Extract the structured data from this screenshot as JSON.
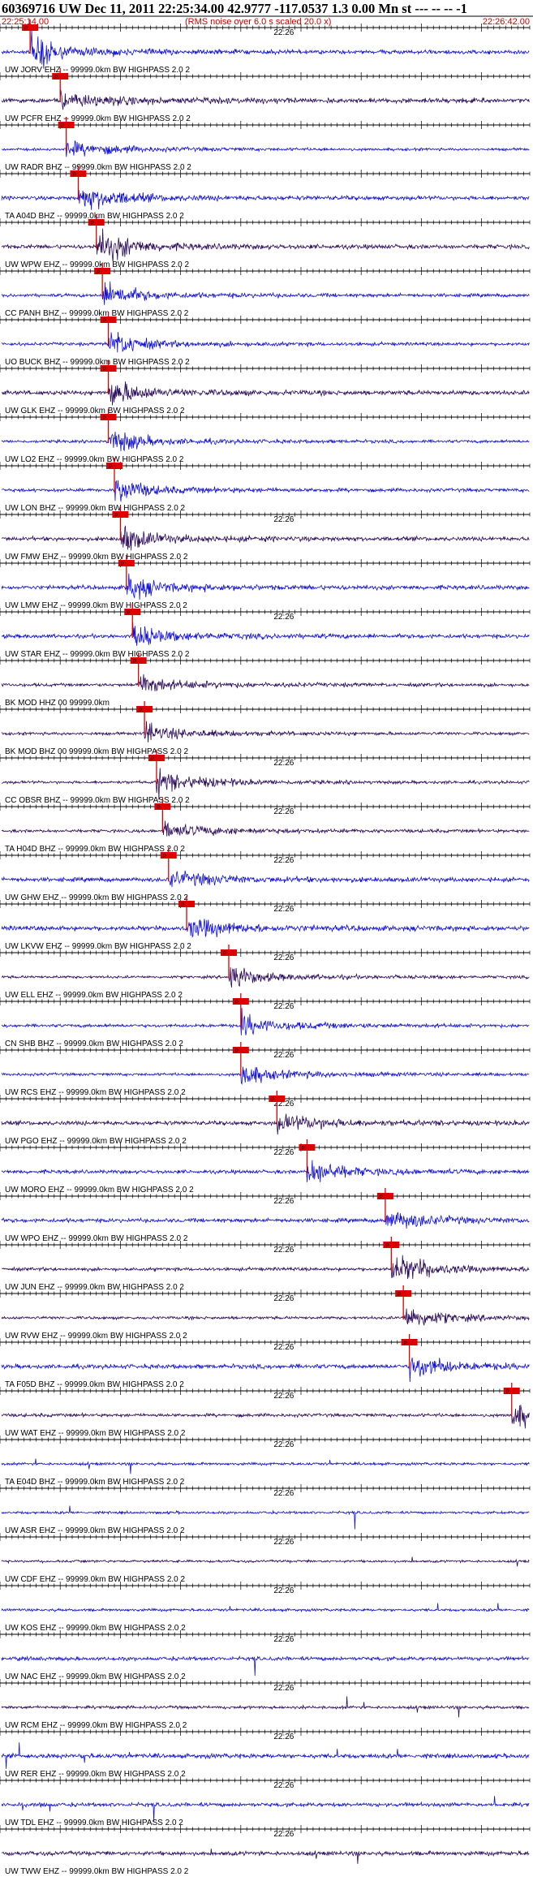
{
  "header": {
    "title": "60369716 UW Dec 11, 2011 22:25:34.00   42.9777 -117.0537  1.3 0.00 Mn st --- -- --  -1",
    "start_time": "22:25:14.00",
    "noise_note": "(RMS noise over 6.0 s scaled 20.0 x)",
    "end_time": "22:26:42.00"
  },
  "colors": {
    "trace_blue": "#1010d8",
    "trace_dark": "#2a0a5a",
    "pick_line": "#dd0000",
    "pick_box": "#dd0000",
    "axis": "#000000",
    "title_red": "#cc0000"
  },
  "chart_data": {
    "type": "line",
    "x_range": [
      "22:25:14.00",
      "22:26:42.00"
    ],
    "minute_mark": "22:26",
    "pick_label": "P",
    "traces": [
      {
        "label": "UW JORV EHZ -- 99999.0km BW  HIGHPASS  2.0  2",
        "pick": "22:25:19",
        "shows_minute_mark": true
      },
      {
        "label": "UW PCFR EHZ -- 99999.0km BW  HIGHPASS  2.0  2",
        "pick": "22:25:24",
        "shows_minute_mark": false
      },
      {
        "label": "UW RADR BHZ -- 99999.0km BW  HIGHPASS  2.0  2",
        "pick": "22:25:25",
        "shows_minute_mark": false
      },
      {
        "label": "TA A04D BHZ -- 99999.0km BW  HIGHPASS  2.0  2",
        "pick": "22:25:27",
        "shows_minute_mark": false
      },
      {
        "label": "UW WPW EHZ -- 99999.0km BW  HIGHPASS  2.0  2",
        "pick": "22:25:30",
        "shows_minute_mark": false
      },
      {
        "label": "CC PANH BHZ -- 99999.0km BW  HIGHPASS  2.0  2",
        "pick": "22:25:31",
        "shows_minute_mark": false
      },
      {
        "label": "UO BUCK BHZ -- 99999.0km BW  HIGHPASS  2.0  2",
        "pick": "22:25:32",
        "shows_minute_mark": false
      },
      {
        "label": "UW GLK EHZ -- 99999.0km BW  HIGHPASS  2.0  2",
        "pick": "22:25:32",
        "shows_minute_mark": false
      },
      {
        "label": "UW LO2 EHZ -- 99999.0km BW  HIGHPASS  2.0  2",
        "pick": "22:25:32",
        "shows_minute_mark": false
      },
      {
        "label": "UW LON BHZ -- 99999.0km BW  HIGHPASS  2.0  2",
        "pick": "22:25:33",
        "shows_minute_mark": false
      },
      {
        "label": "UW FMW EHZ -- 99999.0km BW  HIGHPASS  2.0  2",
        "pick": "22:25:34",
        "shows_minute_mark": true
      },
      {
        "label": "UW LMW EHZ -- 99999.0km BW  HIGHPASS  2.0  2",
        "pick": "22:25:35",
        "shows_minute_mark": false
      },
      {
        "label": "UW STAR EHZ -- 99999.0km BW  HIGHPASS  2.0  2",
        "pick": "22:25:36",
        "shows_minute_mark": true
      },
      {
        "label": "BK MOD HHZ 00 99999.0km",
        "pick": "22:25:37",
        "shows_minute_mark": false
      },
      {
        "label": "BK MOD BHZ 00 99999.0km BW  HIGHPASS  2.0  2",
        "pick": "22:25:38",
        "shows_minute_mark": false
      },
      {
        "label": "CC OBSR BHZ -- 99999.0km BW  HIGHPASS  2.0  2",
        "pick": "22:25:40",
        "shows_minute_mark": true
      },
      {
        "label": "TA H04D BHZ -- 99999.0km BW  HIGHPASS  2.0  2",
        "pick": "22:25:41",
        "shows_minute_mark": true
      },
      {
        "label": "UW GHW EHZ -- 99999.0km BW  HIGHPASS  2.0  2",
        "pick": "22:25:42",
        "shows_minute_mark": true
      },
      {
        "label": "UW LKVW EHZ -- 99999.0km BW  HIGHPASS  2.0  2",
        "pick": "22:25:45",
        "shows_minute_mark": true
      },
      {
        "label": "UW ELL EHZ -- 99999.0km BW  HIGHPASS  2.0  2",
        "pick": "22:25:52",
        "shows_minute_mark": true
      },
      {
        "label": "CN SHB BHZ -- 99999.0km BW  HIGHPASS  2.0  2",
        "pick": "22:25:54",
        "shows_minute_mark": true
      },
      {
        "label": "UW RCS EHZ -- 99999.0km BW  HIGHPASS  2.0  2",
        "pick": "22:25:54",
        "shows_minute_mark": true
      },
      {
        "label": "UW PGO EHZ -- 99999.0km BW  HIGHPASS  2.0  2",
        "pick": "22:26:00",
        "shows_minute_mark": true
      },
      {
        "label": "UW MORO EHZ -- 99999.0km BW  HIGHPASS  2.0  2",
        "pick": "22:26:05",
        "shows_minute_mark": true
      },
      {
        "label": "UW WPO EHZ -- 99999.0km BW  HIGHPASS  2.0  2",
        "pick": "22:26:18",
        "shows_minute_mark": true
      },
      {
        "label": "UW JUN EHZ -- 99999.0km BW  HIGHPASS  2.0  2",
        "pick": "22:26:19",
        "shows_minute_mark": true
      },
      {
        "label": "UW RVW EHZ -- 99999.0km BW  HIGHPASS  2.0  2",
        "pick": "22:26:21",
        "shows_minute_mark": true
      },
      {
        "label": "TA F05D BHZ -- 99999.0km BW  HIGHPASS  2.0  2",
        "pick": "22:26:22",
        "shows_minute_mark": true
      },
      {
        "label": "UW WAT EHZ -- 99999.0km BW  HIGHPASS  2.0  2",
        "pick": "22:26:39",
        "shows_minute_mark": true
      },
      {
        "label": "TA E04D BHZ -- 99999.0km BW  HIGHPASS  2.0  2",
        "pick": null,
        "shows_minute_mark": true
      },
      {
        "label": "UW ASR EHZ -- 99999.0km BW  HIGHPASS  2.0  2",
        "pick": null,
        "shows_minute_mark": true
      },
      {
        "label": "UW CDF EHZ -- 99999.0km BW  HIGHPASS  2.0  2",
        "pick": null,
        "shows_minute_mark": true
      },
      {
        "label": "UW KOS EHZ -- 99999.0km BW  HIGHPASS  2.0  2",
        "pick": null,
        "shows_minute_mark": true
      },
      {
        "label": "UW NAC EHZ -- 99999.0km BW  HIGHPASS  2.0  2",
        "pick": null,
        "shows_minute_mark": true
      },
      {
        "label": "UW RCM EHZ -- 99999.0km BW  HIGHPASS  2.0  2",
        "pick": null,
        "shows_minute_mark": true
      },
      {
        "label": "UW RER EHZ -- 99999.0km BW  HIGHPASS  2.0  2",
        "pick": null,
        "shows_minute_mark": true
      },
      {
        "label": "UW TDL EHZ -- 99999.0km BW  HIGHPASS  2.0  2",
        "pick": null,
        "shows_minute_mark": true
      },
      {
        "label": "UW TWW EHZ -- 99999.0km BW  HIGHPASS  2.0  2",
        "pick": null,
        "shows_minute_mark": true
      }
    ]
  }
}
